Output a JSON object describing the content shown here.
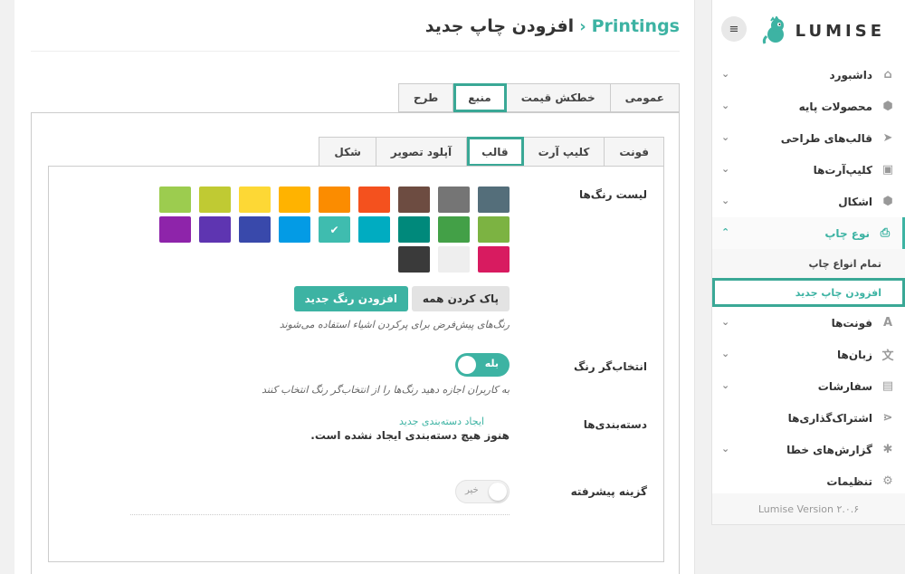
{
  "header": {
    "breadcrumb": "Printings",
    "separator": "‹",
    "title": "افزودن چاپ جدید"
  },
  "tabs_main": [
    {
      "label": "عمومی"
    },
    {
      "label": "خطکش قیمت"
    },
    {
      "label": "منبع"
    },
    {
      "label": "طرح"
    }
  ],
  "tabs_source": [
    {
      "label": "فونت"
    },
    {
      "label": "کلیپ آرت"
    },
    {
      "label": "قالب"
    },
    {
      "label": "آپلود تصویر"
    },
    {
      "label": "شکل"
    }
  ],
  "colors": {
    "label": "لیست رنگ‌ها",
    "list": [
      "#546e7a",
      "#757575",
      "#6d4c41",
      "#f4511e",
      "#fb8c00",
      "#ffb300",
      "#fdd835",
      "#c0ca33",
      "#9ccc4f",
      "#7cb342",
      "#43a047",
      "#00897b",
      "#00acc1",
      "#3fbcaf",
      "#039be5",
      "#3949ab",
      "#5e35b1",
      "#8e24aa",
      "#d81b60",
      "#eeeeee",
      "#3a3a3a"
    ],
    "selected_index": 13,
    "clear_all": "پاک کردن همه",
    "add_color": "افزودن رنگ جدید",
    "help": "رنگ‌های پیش‌فرض برای پرکردن اشیاء استفاده می‌شوند"
  },
  "color_picker": {
    "label": "انتخاب‌گر رنگ",
    "toggle": "بله",
    "help": "به کاربران اجازه دهید رنگ‌ها را از انتخاب‌گر رنگ انتخاب کنند"
  },
  "categories": {
    "label": "دسته‌بندی‌ها",
    "empty": "هنوز هیچ دسته‌بندی ایجاد نشده است.",
    "create_link": "ایجاد دسته‌بندی جدید"
  },
  "advanced": {
    "label": "گزینه پیشرفته",
    "toggle": "خیر"
  },
  "sidebar": {
    "menu_icon": "≡",
    "logo_text": "LUMISE",
    "items": [
      {
        "label": "داشبورد",
        "icon": "⌂"
      },
      {
        "label": "محصولات پایه",
        "icon": "⬢"
      },
      {
        "label": "قالب‌های طراحی",
        "icon": "➤"
      },
      {
        "label": "کلیپ‌آرت‌ها",
        "icon": "▣"
      },
      {
        "label": "اشکال",
        "icon": "⬢"
      },
      {
        "label": "نوع چاپ",
        "icon": "⎙"
      },
      {
        "label": "فونت‌ها",
        "icon": "A"
      },
      {
        "label": "زبان‌ها",
        "icon": "文"
      },
      {
        "label": "سفارشات",
        "icon": "▤"
      },
      {
        "label": "اشتراک‌گذاری‌ها",
        "icon": "⋖"
      },
      {
        "label": "گزارش‌های خطا",
        "icon": "✱"
      },
      {
        "label": "تنظیمات",
        "icon": "⚙"
      }
    ],
    "sub_items": [
      {
        "label": "تمام انواع چاپ"
      },
      {
        "label": "افزودن چاپ جدید"
      }
    ],
    "version": "Lumise Version ۲.۰.۶"
  },
  "accent": "#3db3a3"
}
